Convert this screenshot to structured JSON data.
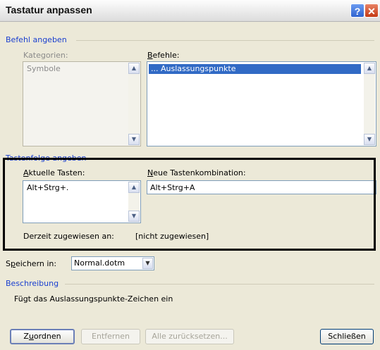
{
  "title": "Tastatur anpassen",
  "titlebar": {
    "help_glyph": "?",
    "close_glyph": "✕"
  },
  "befehl_group": {
    "title": "Befehl angeben",
    "kategorien_label": "Kategorien:",
    "kategorien_items": [
      "Symbole"
    ],
    "befehle_label": "Befehle:",
    "befehle_items": [
      "...        Auslassungspunkte"
    ]
  },
  "tastenfolge_group": {
    "title": "Tastenfolge angeben",
    "aktuelle_label": "Aktuelle Tasten:",
    "aktuelle_items": [
      "Alt+Strg+."
    ],
    "neue_label": "Neue Tastenkombination:",
    "neue_value": "Alt+Strg+A",
    "zugewiesen_label": "Derzeit zugewiesen an:",
    "zugewiesen_value": "[nicht zugewiesen]"
  },
  "speichern": {
    "label": "Speichern in:",
    "value": "Normal.dotm"
  },
  "beschreibung": {
    "title": "Beschreibung",
    "text": "Fügt das  Auslassungspunkte-Zeichen ein"
  },
  "buttons": {
    "zuordnen": "Zuordnen",
    "entfernen": "Entfernen",
    "alle_zuruecksetzen": "Alle zurücksetzen...",
    "schliessen": "Schließen"
  },
  "colors": {
    "group_title": "#1a3fcf",
    "selection": "#316ac5",
    "highlight_frame": "#000000"
  },
  "icons": {
    "scroll_up": "▲",
    "scroll_down": "▼",
    "dropdown": "▼"
  }
}
